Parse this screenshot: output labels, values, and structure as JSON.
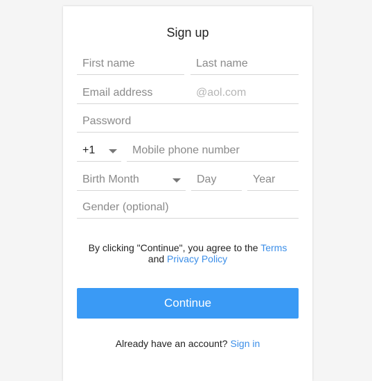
{
  "form": {
    "title": "Sign up",
    "first_name_placeholder": "First name",
    "last_name_placeholder": "Last name",
    "email_placeholder": "Email address",
    "email_suffix": "@aol.com",
    "password_placeholder": "Password",
    "country_code": "+1",
    "phone_placeholder": "Mobile phone number",
    "birth_month_placeholder": "Birth Month",
    "day_placeholder": "Day",
    "year_placeholder": "Year",
    "gender_placeholder": "Gender (optional)"
  },
  "terms": {
    "prefix": "By clicking \"Continue\", you agree to the ",
    "terms_link": "Terms",
    "and": "and ",
    "privacy_link": "Privacy Policy"
  },
  "continue_label": "Continue",
  "signin": {
    "prompt": "Already have an account? ",
    "link": "Sign in"
  },
  "colors": {
    "accent": "#3a9af5",
    "link": "#3b8ee8"
  }
}
